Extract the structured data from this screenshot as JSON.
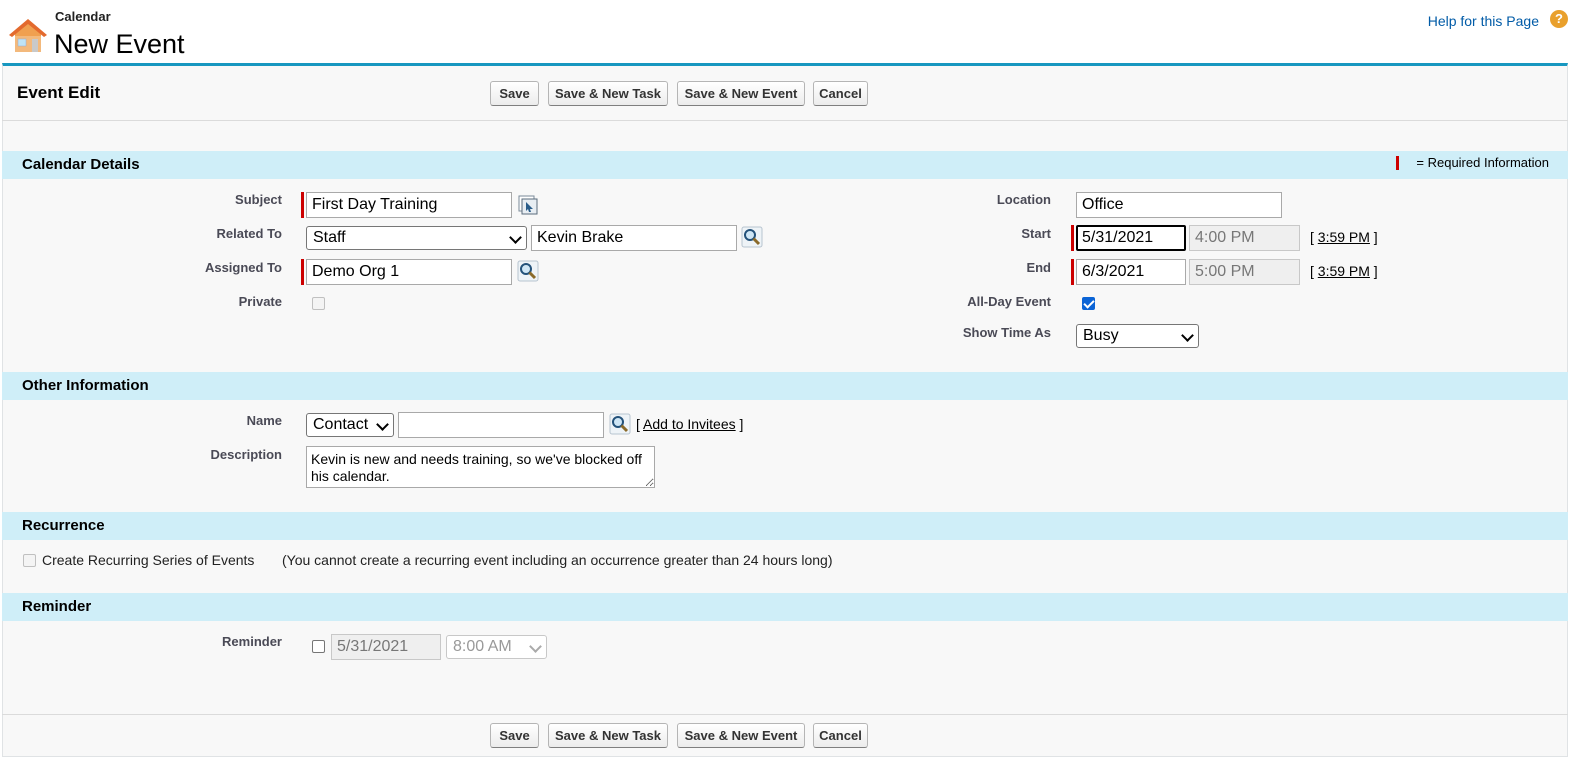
{
  "header": {
    "breadcrumb": "Calendar",
    "title": "New Event",
    "help_link": "Help for this Page",
    "help_icon": "?"
  },
  "edit": {
    "title": "Event Edit",
    "buttons": {
      "save": "Save",
      "save_new_task": "Save & New Task",
      "save_new_event": "Save & New Event",
      "cancel": "Cancel"
    }
  },
  "required_info": "= Required Information",
  "calendar_details": {
    "heading": "Calendar Details",
    "subject": {
      "label": "Subject",
      "value": "First Day Training"
    },
    "related_to": {
      "label": "Related To",
      "type": "Staff",
      "value": "Kevin Brake"
    },
    "assigned_to": {
      "label": "Assigned To",
      "value": "Demo Org 1"
    },
    "private": {
      "label": "Private",
      "checked": false
    },
    "location": {
      "label": "Location",
      "value": "Office"
    },
    "start": {
      "label": "Start",
      "date": "5/31/2021",
      "time": "4:00 PM",
      "now_link": "3:59 PM"
    },
    "end": {
      "label": "End",
      "date": "6/3/2021",
      "time": "5:00 PM",
      "now_link": "3:59 PM"
    },
    "all_day": {
      "label": "All-Day Event",
      "checked": true
    },
    "show_time_as": {
      "label": "Show Time As",
      "value": "Busy"
    }
  },
  "other_information": {
    "heading": "Other Information",
    "name": {
      "label": "Name",
      "type": "Contact",
      "value": "",
      "add_invitees": "Add to Invitees",
      "bracket_open": "[",
      "bracket_close": "]"
    },
    "description": {
      "label": "Description",
      "value": "Kevin is new and needs training, so we've blocked off his calendar."
    }
  },
  "recurrence": {
    "heading": "Recurrence",
    "checkbox_label": "Create Recurring Series of Events",
    "note": "(You cannot create a recurring event including an occurrence greater than 24 hours long)"
  },
  "reminder": {
    "heading": "Reminder",
    "label": "Reminder",
    "date": "5/31/2021",
    "time": "8:00 AM"
  },
  "colors": {
    "accent": "#1797c0",
    "section_bg": "#cfeef8",
    "required": "#cc0000",
    "link": "#015ba7"
  }
}
